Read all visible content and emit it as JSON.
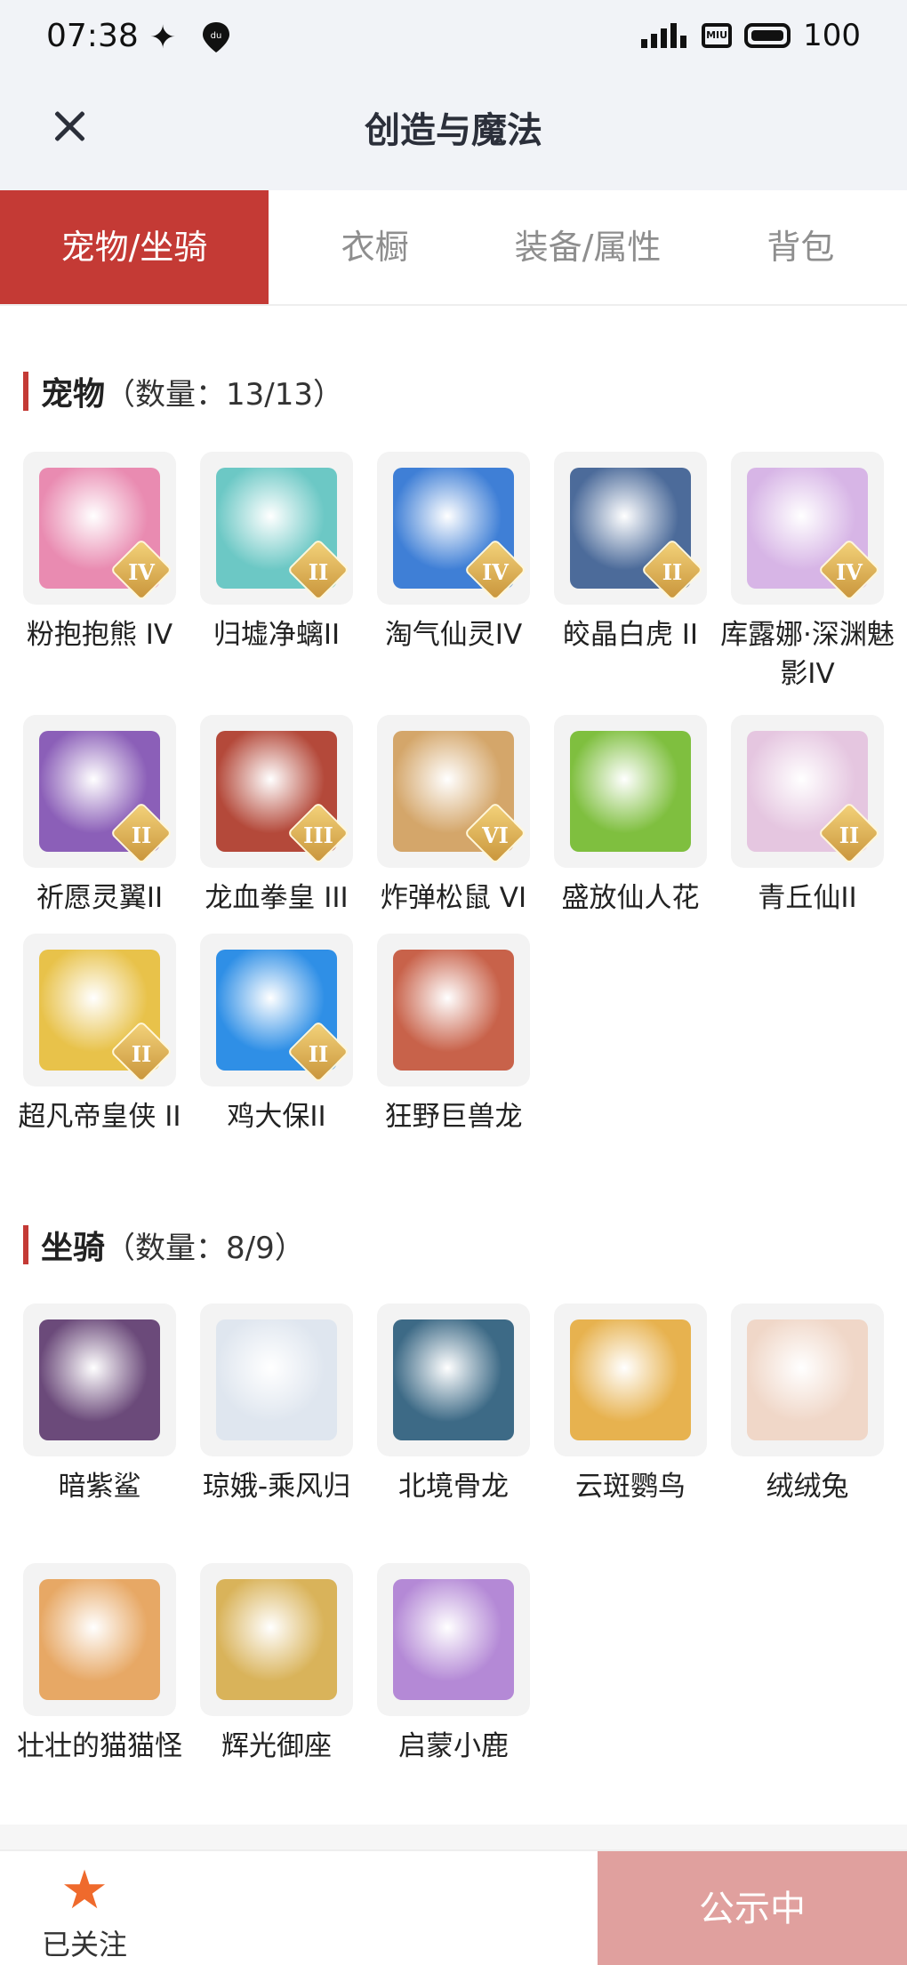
{
  "status_bar": {
    "time": "07:38",
    "sparkle_icon": "sparkle-icon",
    "du_icon": "du",
    "miu_label": "MIU",
    "battery": "100"
  },
  "header": {
    "title": "创造与魔法",
    "close_icon": "close-icon"
  },
  "tabs": [
    {
      "label": "宠物/坐骑",
      "active": true
    },
    {
      "label": "衣橱",
      "active": false
    },
    {
      "label": "装备/属性",
      "active": false
    },
    {
      "label": "背包",
      "active": false
    }
  ],
  "pets": {
    "title": "宠物",
    "count": "（数量：13/13）",
    "items": [
      {
        "name": "粉抱抱熊 IV",
        "badge": "IV",
        "color": "#e98bb1"
      },
      {
        "name": "归墟净螭II",
        "badge": "II",
        "color": "#6cc8c5"
      },
      {
        "name": "淘气仙灵IV",
        "badge": "IV",
        "color": "#3f7fd6"
      },
      {
        "name": "皎晶白虎 II",
        "badge": "II",
        "color": "#4c6b9a"
      },
      {
        "name": "库露娜·深渊魅影IV",
        "badge": "IV",
        "color": "#d7b5e6"
      },
      {
        "name": "祈愿灵翼II",
        "badge": "II",
        "color": "#8b5fb8"
      },
      {
        "name": "龙血拳皇 III",
        "badge": "III",
        "color": "#b4493a"
      },
      {
        "name": "炸弹松鼠 VI",
        "badge": "VI",
        "color": "#d4a66a"
      },
      {
        "name": "盛放仙人花",
        "badge": "",
        "color": "#7fbf3f"
      },
      {
        "name": "青丘仙II",
        "badge": "II",
        "color": "#e5c6e0"
      },
      {
        "name": "超凡帝皇侠 II",
        "badge": "II",
        "color": "#e8c24a"
      },
      {
        "name": "鸡大保II",
        "badge": "II",
        "color": "#2f8fe6"
      },
      {
        "name": "狂野巨兽龙",
        "badge": "",
        "color": "#c8624a"
      }
    ]
  },
  "mounts": {
    "title": "坐骑",
    "count": "（数量：8/9）",
    "items": [
      {
        "name": "暗紫鲨",
        "color": "#6b4a7a"
      },
      {
        "name": "琼娥-乘风归",
        "color": "#dfe6ef"
      },
      {
        "name": "北境骨龙",
        "color": "#3d6a86"
      },
      {
        "name": "云斑鹦鸟",
        "color": "#e7b24f"
      },
      {
        "name": "绒绒兔",
        "color": "#f0d7c8"
      },
      {
        "name": "壮壮的猫猫怪",
        "color": "#e7a865"
      },
      {
        "name": "辉光御座",
        "color": "#d9b35a"
      },
      {
        "name": "启蒙小鹿",
        "color": "#b489d6"
      }
    ]
  },
  "bottom": {
    "follow_label": "已关注",
    "star_icon": "star-icon",
    "public_label": "公示中"
  }
}
